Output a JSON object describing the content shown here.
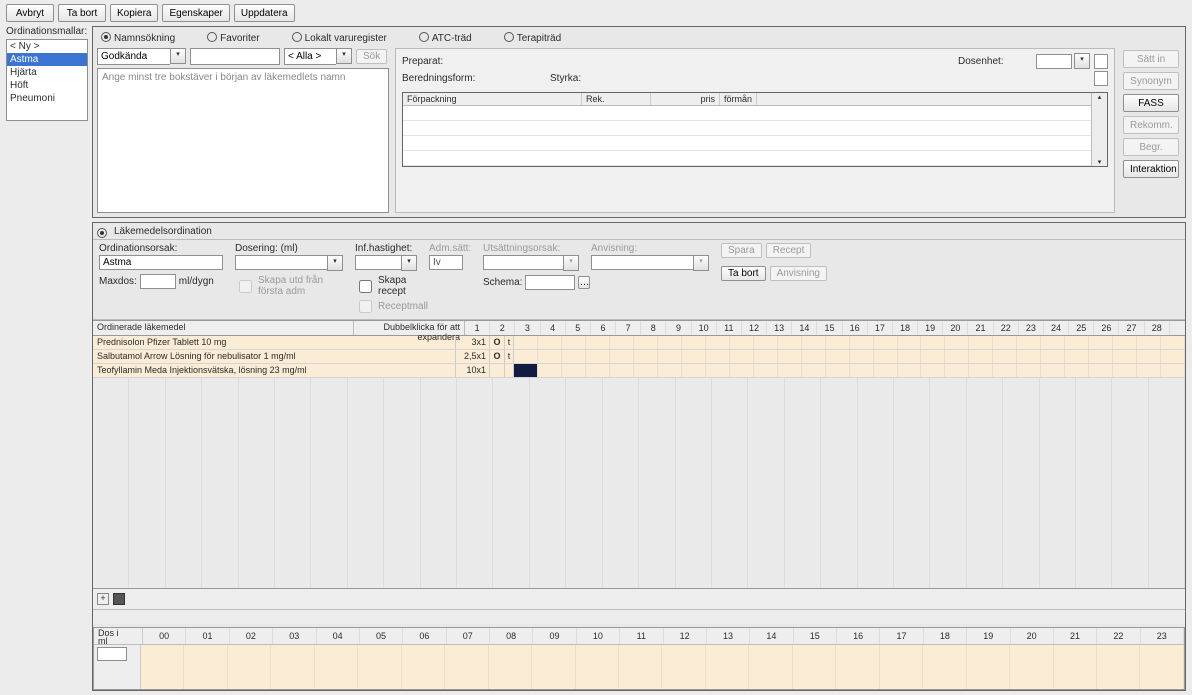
{
  "toolbar": {
    "avbryt": "Avbryt",
    "tabort": "Ta bort",
    "kopiera": "Kopiera",
    "egenskaper": "Egenskaper",
    "uppdatera": "Uppdatera"
  },
  "sidebar": {
    "title": "Ordinationsmallar:",
    "items": [
      "< Ny >",
      "Astma",
      "Hjärta",
      "Höft",
      "Pneumoni"
    ],
    "selected": "Astma"
  },
  "search": {
    "radios": {
      "namn": "Namnsökning",
      "fav": "Favoriter",
      "lokal": "Lokalt varuregister",
      "atc": "ATC-träd",
      "terapi": "Terapiträd"
    },
    "filter": "Godkända",
    "alla": "< Alla >",
    "sok": "Sök",
    "hint": "Ange minst tre bokstäver i början av läkemedlets namn",
    "labels": {
      "preparat": "Preparat:",
      "dosenhet": "Dosenhet:",
      "beredningsform": "Beredningsform:",
      "styrka": "Styrka:"
    },
    "pack_headers": {
      "forpackning": "Förpackning",
      "rek": "Rek.",
      "pris": "pris",
      "forman": "förmån"
    },
    "buttons": {
      "satt_in": "Sätt in",
      "synonym": "Synonym",
      "fass": "FASS",
      "rekomm": "Rekomm.",
      "begr": "Begr.",
      "interaktion": "Interaktion"
    }
  },
  "ord": {
    "title": "Läkemedelsordination",
    "orsak": {
      "label": "Ordinationsorsak:",
      "value": "Astma"
    },
    "dosering": {
      "label": "Dosering: (ml)"
    },
    "inf": {
      "label": "Inf.hastighet:"
    },
    "adm": {
      "label": "Adm.sätt:",
      "value": "Iv"
    },
    "utsatt": {
      "label": "Utsättningsorsak:"
    },
    "anvis": {
      "label": "Anvisning:"
    },
    "max": {
      "label": "Maxdos:",
      "unit": "ml/dygn"
    },
    "chk_skapa_utd": "Skapa utd från första adm",
    "chk_skapa_recept": "Skapa recept",
    "chk_receptmall": "Receptmall",
    "schema": "Schema:",
    "btn_spara": "Spara",
    "btn_recept": "Recept",
    "btn_tabort": "Ta bort",
    "btn_anvisning": "Anvisning"
  },
  "grid": {
    "head_ord": "Ordinerade läkemedel",
    "head_dub": "Dubbelklicka för att expandera",
    "rows": [
      {
        "name": "Prednisolon Pfizer Tablett 10 mg",
        "val": "3x1",
        "icon": "O",
        "lit": "t"
      },
      {
        "name": "Salbutamol Arrow Lösning för nebulisator 1 mg/ml",
        "val": "2,5x1",
        "icon": "O",
        "lit": "t"
      },
      {
        "name": "Teofyllamin Meda Injektionsvätska, lösning 23 mg/ml",
        "val": "10x1",
        "icon": "",
        "lit": "",
        "mark": true
      }
    ]
  },
  "dose": {
    "label1": "Dos i",
    "label2": "ml"
  }
}
